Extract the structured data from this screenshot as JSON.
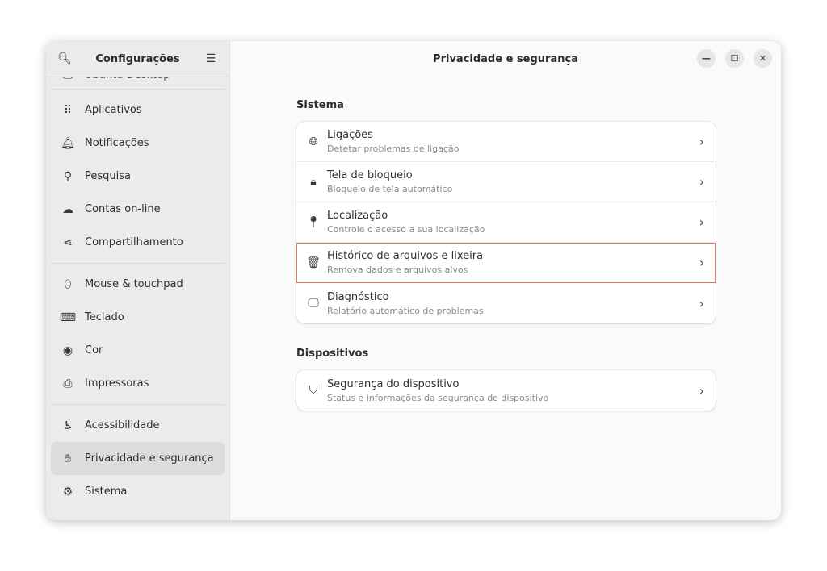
{
  "sidebar": {
    "title": "Configurações",
    "partial_item": "Ubuntu Desktop",
    "groups": [
      [
        {
          "label": "Aplicativos",
          "icon": "apps-grid-icon"
        },
        {
          "label": "Notificações",
          "icon": "bell-icon"
        },
        {
          "label": "Pesquisa",
          "icon": "search-icon"
        },
        {
          "label": "Contas on-line",
          "icon": "cloud-icon"
        },
        {
          "label": "Compartilhamento",
          "icon": "share-icon"
        }
      ],
      [
        {
          "label": "Mouse & touchpad",
          "icon": "mouse-icon"
        },
        {
          "label": "Teclado",
          "icon": "keyboard-icon"
        },
        {
          "label": "Cor",
          "icon": "color-icon"
        },
        {
          "label": "Impressoras",
          "icon": "printer-icon"
        }
      ],
      [
        {
          "label": "Acessibilidade",
          "icon": "accessibility-icon"
        },
        {
          "label": "Privacidade e segurança",
          "icon": "hand-icon",
          "selected": true
        },
        {
          "label": "Sistema",
          "icon": "gear-icon"
        }
      ]
    ]
  },
  "header": {
    "title": "Privacidade e segurança"
  },
  "main": {
    "groups": [
      {
        "title": "Sistema",
        "rows": [
          {
            "title": "Ligações",
            "subtitle": "Detetar problemas de ligação",
            "icon": "globe-icon"
          },
          {
            "title": "Tela de bloqueio",
            "subtitle": "Bloqueio de tela automático",
            "icon": "lock-icon"
          },
          {
            "title": "Localização",
            "subtitle": "Controle o acesso a sua localização",
            "icon": "location-pin-icon"
          },
          {
            "title": "Histórico de arquivos e lixeira",
            "subtitle": "Remova dados e arquivos alvos",
            "icon": "trash-icon",
            "highlighted": true
          },
          {
            "title": "Diagnóstico",
            "subtitle": "Relatório automático de problemas",
            "icon": "diagnostics-icon"
          }
        ]
      },
      {
        "title": "Dispositivos",
        "rows": [
          {
            "title": "Segurança do dispositivo",
            "subtitle": "Status e informações da segurança do dispositivo",
            "icon": "shield-icon"
          }
        ]
      }
    ]
  },
  "colors": {
    "highlight_border": "#e0775a",
    "sidebar_bg": "#ebebeb",
    "selected_bg": "#dcdcdc"
  }
}
